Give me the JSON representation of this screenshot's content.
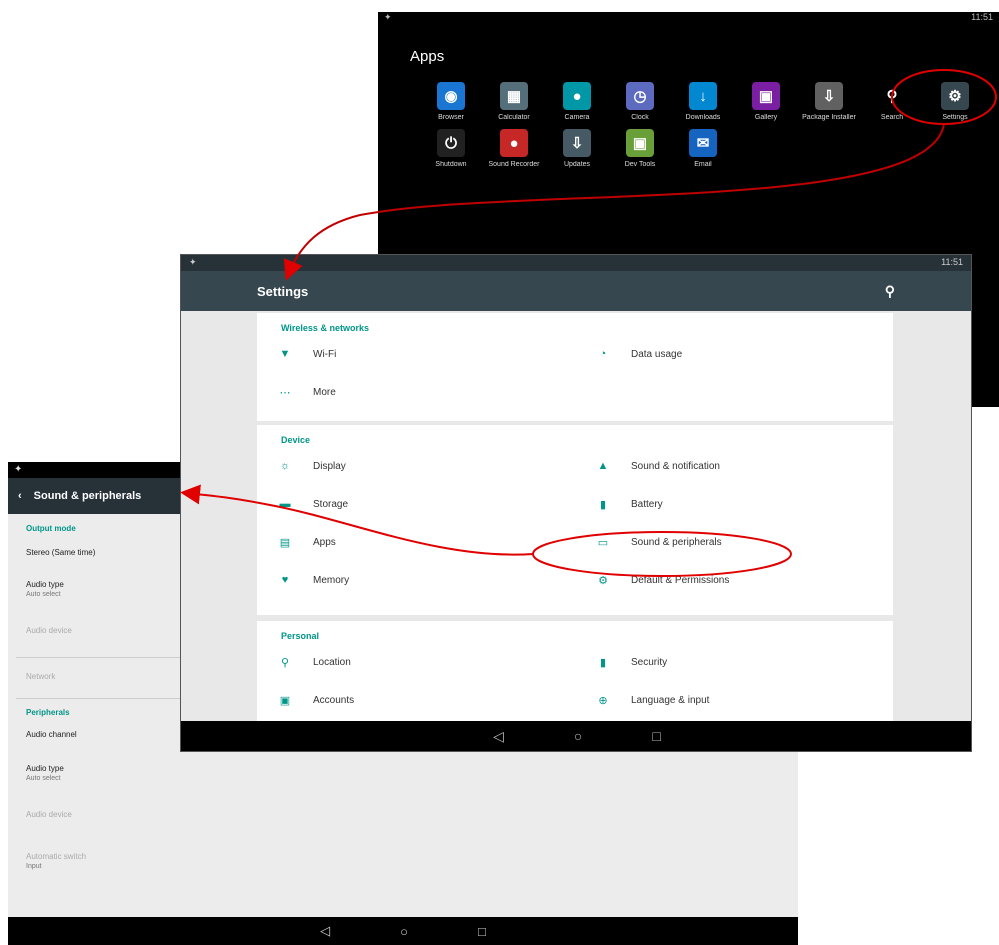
{
  "apps_screen": {
    "title": "Apps",
    "status_right": "11:51",
    "row1": [
      {
        "label": "Browser",
        "icon": "globe-icon",
        "color": "#1976d2",
        "glyph": "◉"
      },
      {
        "label": "Calculator",
        "icon": "calculator-icon",
        "color": "#546e7a",
        "glyph": "▦"
      },
      {
        "label": "Camera",
        "icon": "camera-icon",
        "color": "#0097a7",
        "glyph": "●"
      },
      {
        "label": "Clock",
        "icon": "clock-icon",
        "color": "#5c6bc0",
        "glyph": "◷"
      },
      {
        "label": "Downloads",
        "icon": "download-icon",
        "color": "#0288d1",
        "glyph": "↓"
      },
      {
        "label": "Gallery",
        "icon": "gallery-icon",
        "color": "#7b1fa2",
        "glyph": "▣"
      },
      {
        "label": "Package Installer",
        "icon": "package-icon",
        "color": "#616161",
        "glyph": "⇩"
      },
      {
        "label": "Search",
        "icon": "search-icon",
        "color": "#000000",
        "glyph": "⚲"
      },
      {
        "label": "Settings",
        "icon": "gear-icon",
        "color": "#37474f",
        "glyph": "⚙"
      }
    ],
    "row2": [
      {
        "label": "Shutdown",
        "icon": "power-icon",
        "color": "#212121",
        "glyph": "⏻"
      },
      {
        "label": "Sound Recorder",
        "icon": "microphone-icon",
        "color": "#c62828",
        "glyph": "●"
      },
      {
        "label": "Updates",
        "icon": "update-icon",
        "color": "#455a64",
        "glyph": "⇩"
      },
      {
        "label": "Dev Tools",
        "icon": "android-icon",
        "color": "#689f38",
        "glyph": "▣"
      },
      {
        "label": "Email",
        "icon": "email-icon",
        "color": "#1565c0",
        "glyph": "✉"
      }
    ]
  },
  "settings_screen": {
    "title": "Settings",
    "status_right": "11:51",
    "sections": [
      {
        "header": "Wireless & networks",
        "left": [
          {
            "label": "Wi-Fi",
            "icon": "wifi-icon",
            "glyph": "▼"
          },
          {
            "label": "More",
            "icon": "more-icon",
            "glyph": "⋯"
          }
        ],
        "right": [
          {
            "label": "Data usage",
            "icon": "data-usage-icon",
            "glyph": "◔"
          }
        ]
      },
      {
        "header": "Device",
        "left": [
          {
            "label": "Display",
            "icon": "display-icon",
            "glyph": "☼"
          },
          {
            "label": "Storage",
            "icon": "storage-icon",
            "glyph": "▬"
          },
          {
            "label": "Apps",
            "icon": "apps-icon",
            "glyph": "▤"
          },
          {
            "label": "Memory",
            "icon": "memory-icon",
            "glyph": "♥"
          }
        ],
        "right": [
          {
            "label": "Sound & notification",
            "icon": "bell-icon",
            "glyph": "▲"
          },
          {
            "label": "Battery",
            "icon": "battery-icon",
            "glyph": "▮"
          },
          {
            "label": "Sound & peripherals",
            "icon": "peripherals-icon",
            "glyph": "▭"
          },
          {
            "label": "Default & Permissions",
            "icon": "permissions-icon",
            "glyph": "⚙"
          }
        ]
      },
      {
        "header": "Personal",
        "left": [
          {
            "label": "Location",
            "icon": "location-icon",
            "glyph": "⚲"
          },
          {
            "label": "Accounts",
            "icon": "accounts-icon",
            "glyph": "▣"
          }
        ],
        "right": [
          {
            "label": "Security",
            "icon": "lock-icon",
            "glyph": "▮"
          },
          {
            "label": "Language & input",
            "icon": "globe-icon",
            "glyph": "⊕"
          }
        ]
      }
    ],
    "nav": {
      "back": "◁",
      "home": "○",
      "recents": "□"
    }
  },
  "peripherals_screen": {
    "title": "Sound & peripherals",
    "status_left": "✦",
    "items": [
      {
        "text": "Output mode",
        "sub": "",
        "kind": "hdr"
      },
      {
        "text": "Stereo (Same time)",
        "sub": "",
        "kind": ""
      },
      {
        "text": "Audio type",
        "sub": "Auto select",
        "kind": ""
      },
      {
        "text": "Audio device",
        "sub": "",
        "kind": "dim"
      },
      {
        "text": "Network",
        "sub": "",
        "kind": "dim"
      },
      {
        "text": "Peripherals",
        "sub": "",
        "kind": "hdr"
      },
      {
        "text": "Audio channel",
        "sub": "",
        "kind": ""
      },
      {
        "text": "Audio type",
        "sub": "Auto select",
        "kind": ""
      },
      {
        "text": "Audio device",
        "sub": "",
        "kind": "dim"
      },
      {
        "text": "Automatic switch",
        "sub": "Input",
        "kind": "dim"
      }
    ],
    "nav": {
      "back": "◁",
      "home": "○",
      "recents": "□"
    }
  }
}
